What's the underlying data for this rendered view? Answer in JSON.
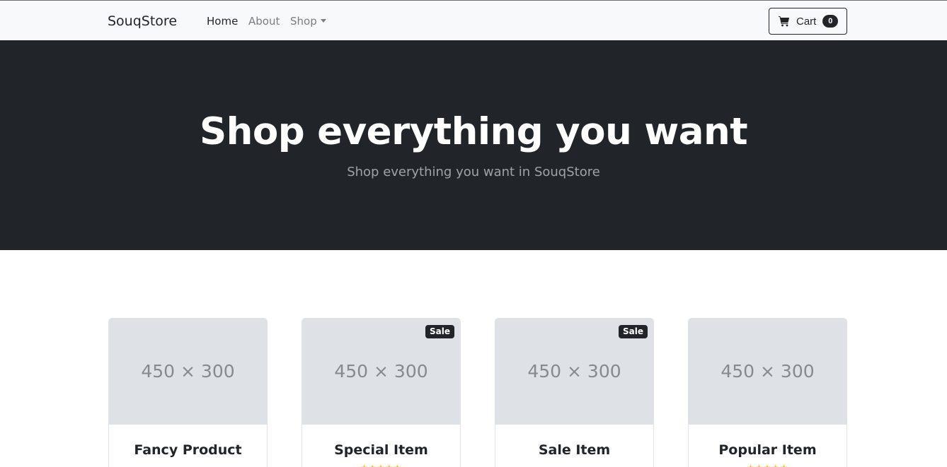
{
  "navbar": {
    "brand": "SouqStore",
    "links": [
      {
        "label": "Home"
      },
      {
        "label": "About"
      },
      {
        "label": "Shop"
      }
    ],
    "cart": {
      "label": "Cart",
      "count": "0"
    }
  },
  "hero": {
    "title": "Shop everything you want",
    "subtitle": "Shop everything you want in SouqStore"
  },
  "products": [
    {
      "title": "Fancy Product",
      "image_text": "450 × 300",
      "badge": "",
      "stars": ""
    },
    {
      "title": "Special Item",
      "image_text": "450 × 300",
      "badge": "Sale",
      "stars": "★★★★★"
    },
    {
      "title": "Sale Item",
      "image_text": "450 × 300",
      "badge": "Sale",
      "stars": ""
    },
    {
      "title": "Popular Item",
      "image_text": "450 × 300",
      "badge": "",
      "stars": "★★★★★"
    }
  ],
  "colors": {
    "navbar_bg": "#f8f9fa",
    "hero_bg": "#212529",
    "card_image_bg": "#dee2e6",
    "star": "#ffc107"
  }
}
